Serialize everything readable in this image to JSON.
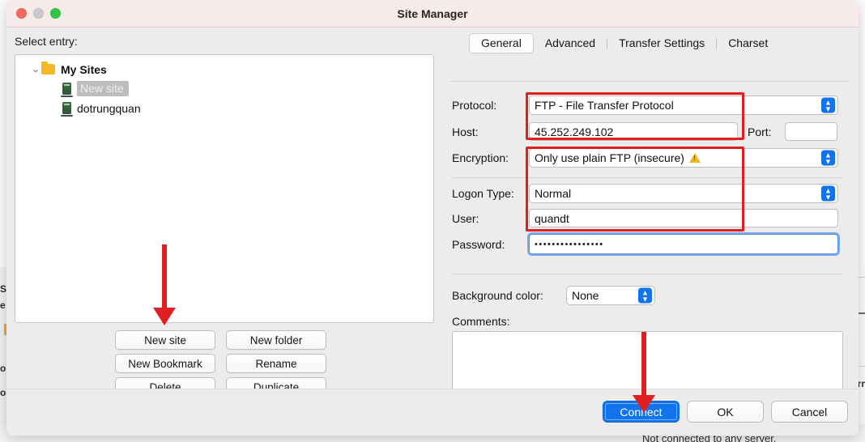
{
  "window": {
    "title": "Site Manager",
    "traffic_lights": [
      "close-button",
      "minimize-button",
      "zoom-button"
    ]
  },
  "left_pane": {
    "select_entry_label": "Select entry:",
    "tree": [
      {
        "label": "My Sites",
        "icon": "folder-icon",
        "level": 0,
        "expanded": true,
        "state": "normal"
      },
      {
        "label": "New site",
        "icon": "server-icon",
        "level": 1,
        "expanded": false,
        "state": "editing"
      },
      {
        "label": "dotrungquan",
        "icon": "server-icon",
        "level": 1,
        "expanded": false,
        "state": "normal"
      }
    ],
    "buttons": [
      {
        "label": "New site"
      },
      {
        "label": "New folder"
      },
      {
        "label": "New Bookmark"
      },
      {
        "label": "Rename"
      },
      {
        "label": "Delete"
      },
      {
        "label": "Duplicate"
      }
    ]
  },
  "right_pane": {
    "tabs": [
      {
        "label": "General",
        "active": true
      },
      {
        "label": "Advanced",
        "active": false
      },
      {
        "label": "Transfer Settings",
        "active": false
      },
      {
        "label": "Charset",
        "active": false
      }
    ],
    "fields": {
      "protocol_label": "Protocol:",
      "protocol_value": "FTP - File Transfer Protocol",
      "host_label": "Host:",
      "host_value": "45.252.249.102",
      "port_label": "Port:",
      "port_value": "",
      "encryption_label": "Encryption:",
      "encryption_value": "Only use plain FTP (insecure)",
      "encryption_warning_icon": "warning-triangle-icon",
      "logon_type_label": "Logon Type:",
      "logon_type_value": "Normal",
      "user_label": "User:",
      "user_value": "quandt",
      "password_label": "Password:",
      "password_value": "••••••••••••••••",
      "background_color_label": "Background color:",
      "background_color_value": "None",
      "comments_label": "Comments:",
      "comments_value": ""
    }
  },
  "footer": {
    "connect_label": "Connect",
    "ok_label": "OK",
    "cancel_label": "Cancel"
  },
  "background": {
    "status_text": "Not connected to any server.",
    "left_glyphs": [
      "S",
      "e",
      "o",
      "o"
    ],
    "right_glyph": "arr"
  },
  "annotations": {
    "color": "#e02020",
    "boxes": [
      {
        "name": "host-encryption-highlight"
      },
      {
        "name": "credentials-highlight"
      }
    ],
    "arrows": [
      {
        "name": "arrow-to-new-site-button"
      },
      {
        "name": "arrow-to-connect-button"
      }
    ]
  },
  "colors": {
    "accent_blue": "#1273ef",
    "annotation_red": "#e02020",
    "warning_yellow": "#f2b726",
    "folder_yellow": "#f4b826",
    "titlebar": "#f7eaea"
  }
}
